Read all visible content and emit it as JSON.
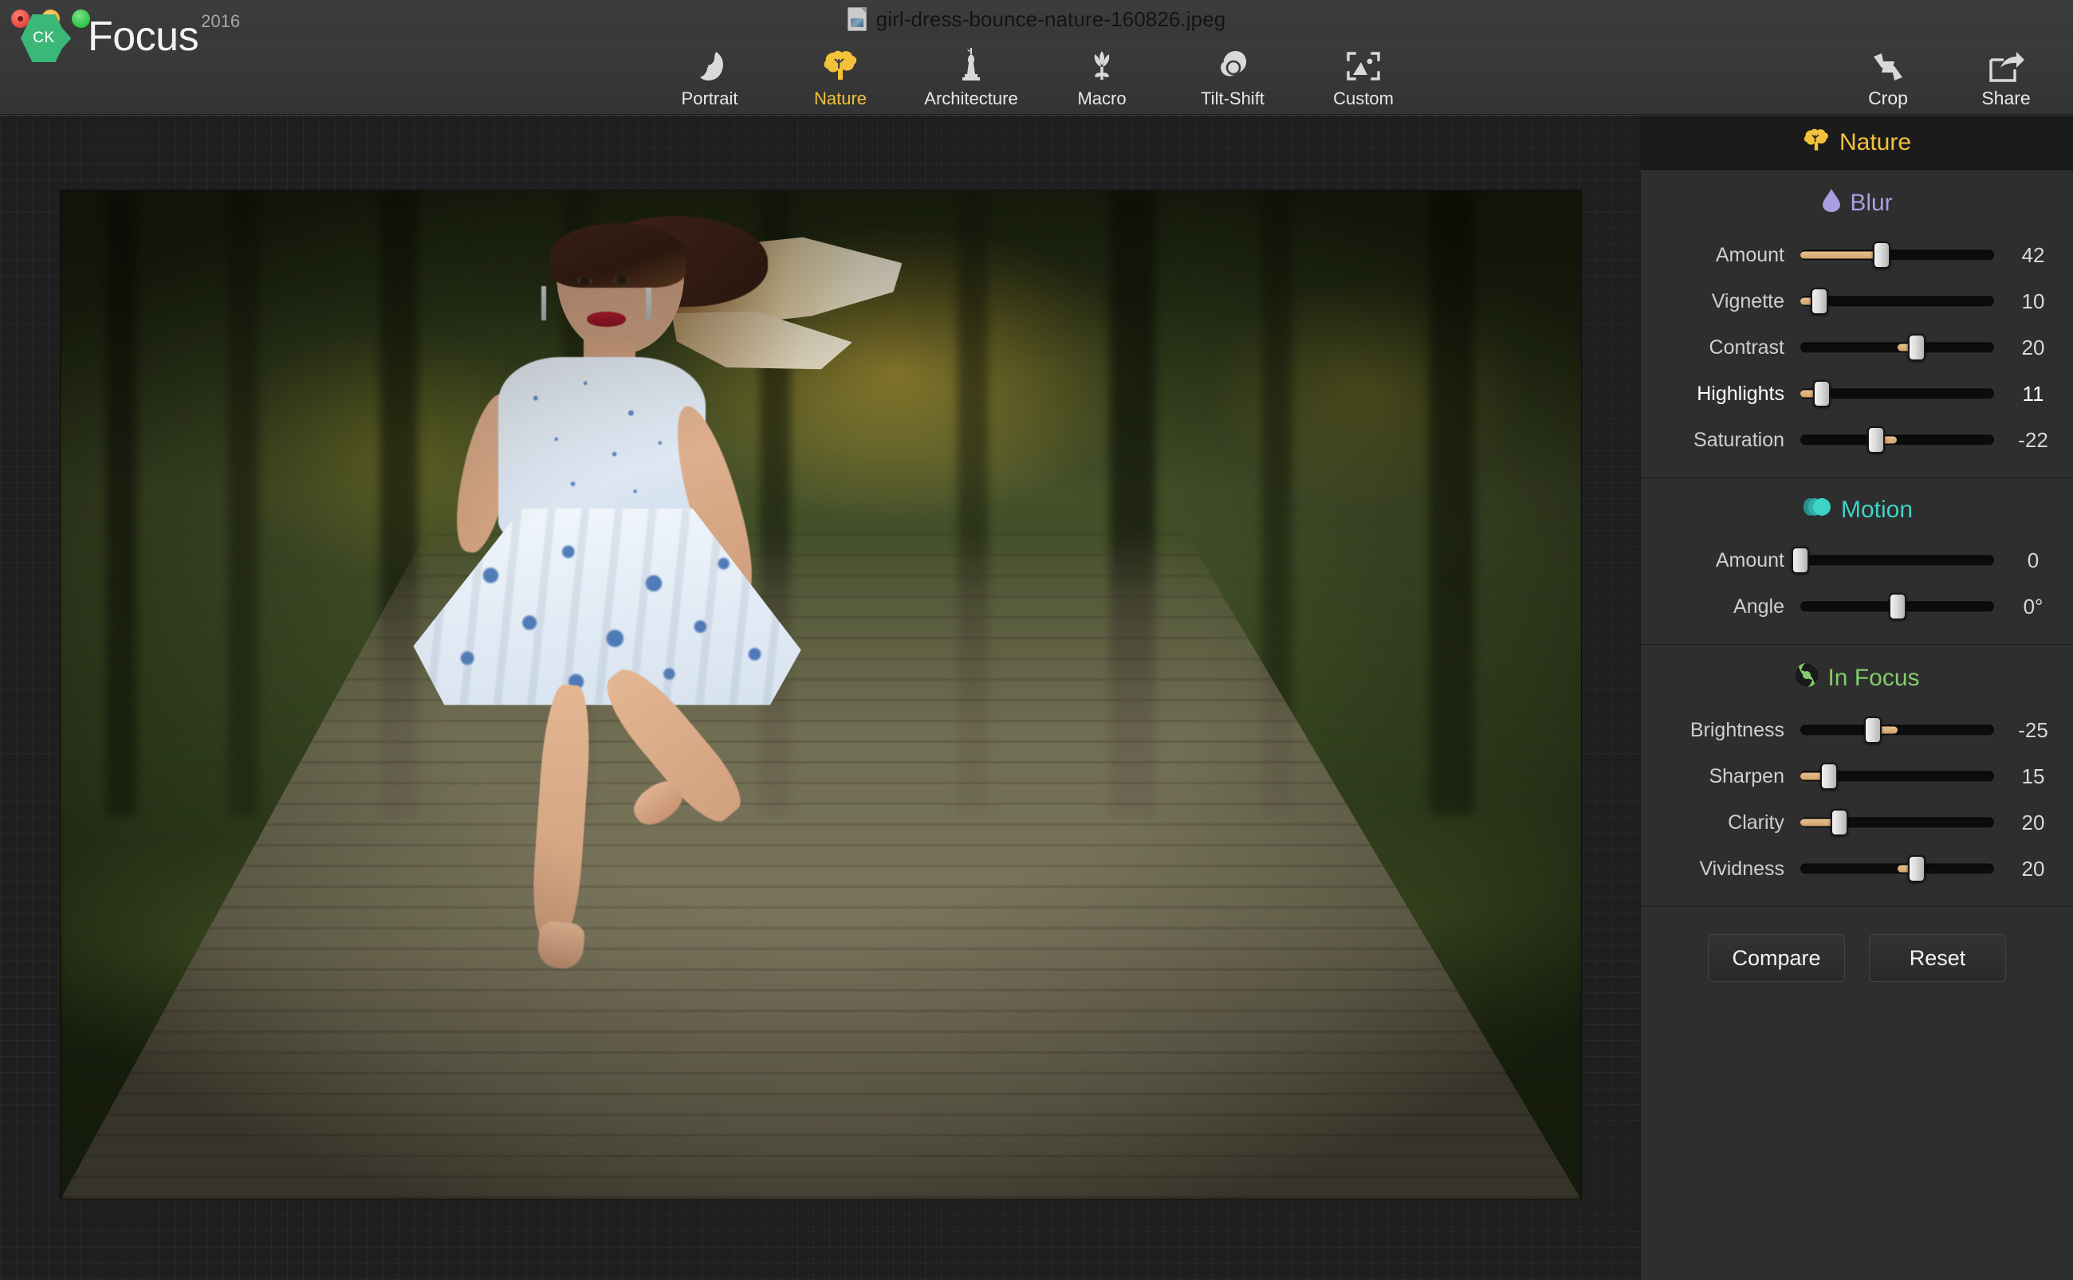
{
  "window": {
    "traffic_lights": [
      "close",
      "minimize",
      "zoom"
    ],
    "document_title": "girl-dress-bounce-nature-160826.jpeg"
  },
  "brand": {
    "mark": "CK",
    "name": "Focus",
    "year": "2016"
  },
  "toolbar": {
    "tabs": [
      {
        "label": "Portrait",
        "icon": "portrait-icon",
        "active": false
      },
      {
        "label": "Nature",
        "icon": "nature-tree-icon",
        "active": true
      },
      {
        "label": "Architecture",
        "icon": "architecture-icon",
        "active": false
      },
      {
        "label": "Macro",
        "icon": "macro-flower-icon",
        "active": false
      },
      {
        "label": "Tilt-Shift",
        "icon": "tilt-shift-icon",
        "active": false
      },
      {
        "label": "Custom",
        "icon": "custom-frame-icon",
        "active": false
      }
    ],
    "actions": [
      {
        "label": "Crop",
        "icon": "crop-icon"
      },
      {
        "label": "Share",
        "icon": "share-icon"
      }
    ]
  },
  "panel": {
    "header": {
      "title": "Nature",
      "icon": "nature-tree-icon",
      "color": "#f3c13a"
    },
    "sections": [
      {
        "title": "Blur",
        "icon": "water-drop-icon",
        "color": "#a79fe0",
        "sliders": [
          {
            "label": "Amount",
            "value": "42",
            "min": 0,
            "max": 100,
            "num": 42,
            "bipolar": false,
            "emphasis": false
          },
          {
            "label": "Vignette",
            "value": "10",
            "min": 0,
            "max": 100,
            "num": 10,
            "bipolar": false,
            "emphasis": false
          },
          {
            "label": "Contrast",
            "value": "20",
            "min": -100,
            "max": 100,
            "num": 20,
            "bipolar": true,
            "emphasis": false
          },
          {
            "label": "Highlights",
            "value": "11",
            "min": 0,
            "max": 100,
            "num": 11,
            "bipolar": false,
            "emphasis": true
          },
          {
            "label": "Saturation",
            "value": "-22",
            "min": -100,
            "max": 100,
            "num": -22,
            "bipolar": true,
            "emphasis": false
          }
        ]
      },
      {
        "title": "Motion",
        "icon": "motion-circles-icon",
        "color": "#3dd3c6",
        "sliders": [
          {
            "label": "Amount",
            "value": "0",
            "min": 0,
            "max": 100,
            "num": 0,
            "bipolar": false,
            "emphasis": false
          },
          {
            "label": "Angle",
            "value": "0°",
            "min": -90,
            "max": 90,
            "num": 0,
            "bipolar": true,
            "emphasis": false
          }
        ]
      },
      {
        "title": "In Focus",
        "icon": "aperture-icon",
        "color": "#83cc6b",
        "sliders": [
          {
            "label": "Brightness",
            "value": "-25",
            "min": -100,
            "max": 100,
            "num": -25,
            "bipolar": true,
            "emphasis": false
          },
          {
            "label": "Sharpen",
            "value": "15",
            "min": 0,
            "max": 100,
            "num": 15,
            "bipolar": false,
            "emphasis": false
          },
          {
            "label": "Clarity",
            "value": "20",
            "min": 0,
            "max": 100,
            "num": 20,
            "bipolar": false,
            "emphasis": false
          },
          {
            "label": "Vividness",
            "value": "20",
            "min": -100,
            "max": 100,
            "num": 20,
            "bipolar": true,
            "emphasis": false
          }
        ]
      }
    ],
    "buttons": [
      {
        "label": "Compare"
      },
      {
        "label": "Reset"
      }
    ]
  },
  "canvas": {
    "photo_alt": "girl in blue floral dress bouncing on a wooden boardwalk in a park at sunset"
  }
}
